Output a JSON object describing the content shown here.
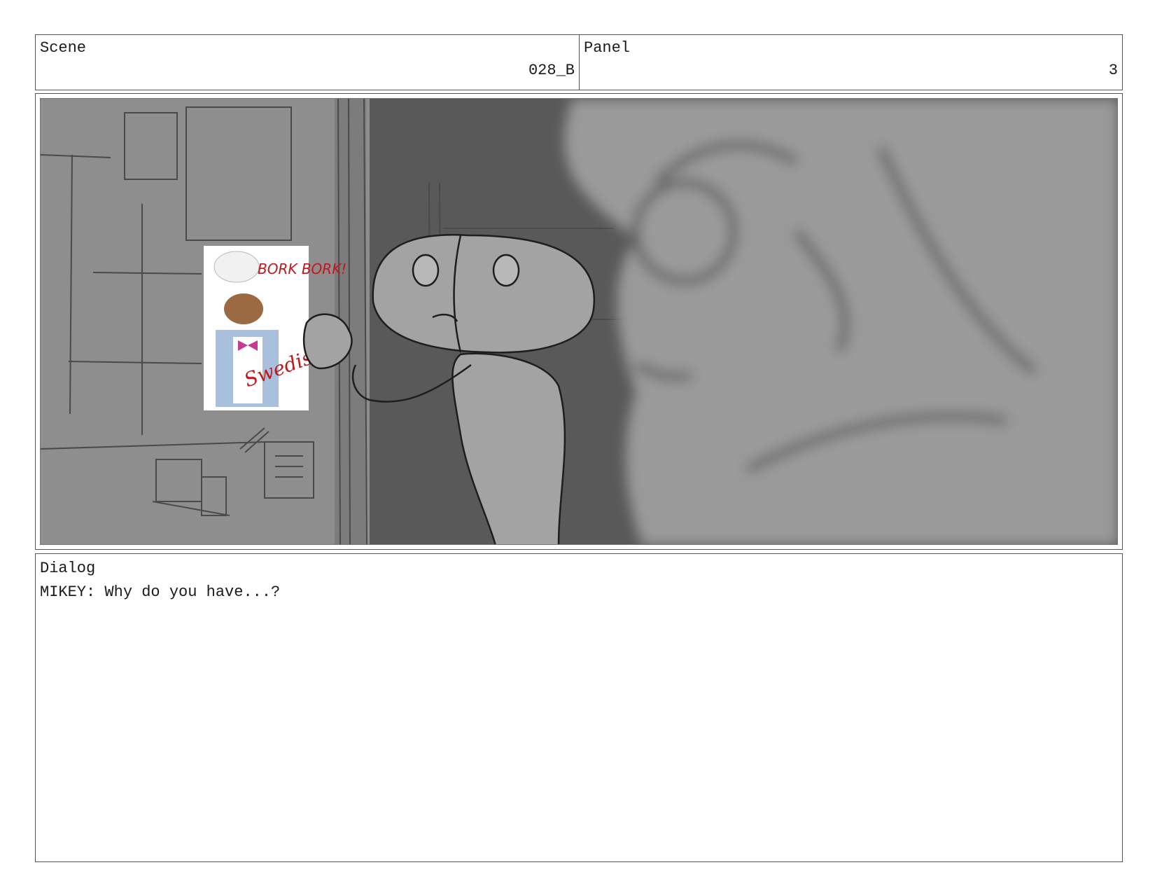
{
  "header": {
    "scene_label": "Scene",
    "scene_value": "028_B",
    "panel_label": "Panel",
    "panel_value": "3"
  },
  "frame": {
    "description_icon": "storyboard-sketch",
    "poster": {
      "handwriting_top": "BORK BORK!",
      "signature": "Swedish C."
    }
  },
  "dialog": {
    "label": "Dialog",
    "lines": [
      "MIKEY: Why do you have...?"
    ]
  },
  "colors": {
    "border": "#555555",
    "sketch_light": "#8a8a8a",
    "sketch_dark": "#5a5a5a",
    "poster_red": "#c0181c"
  }
}
